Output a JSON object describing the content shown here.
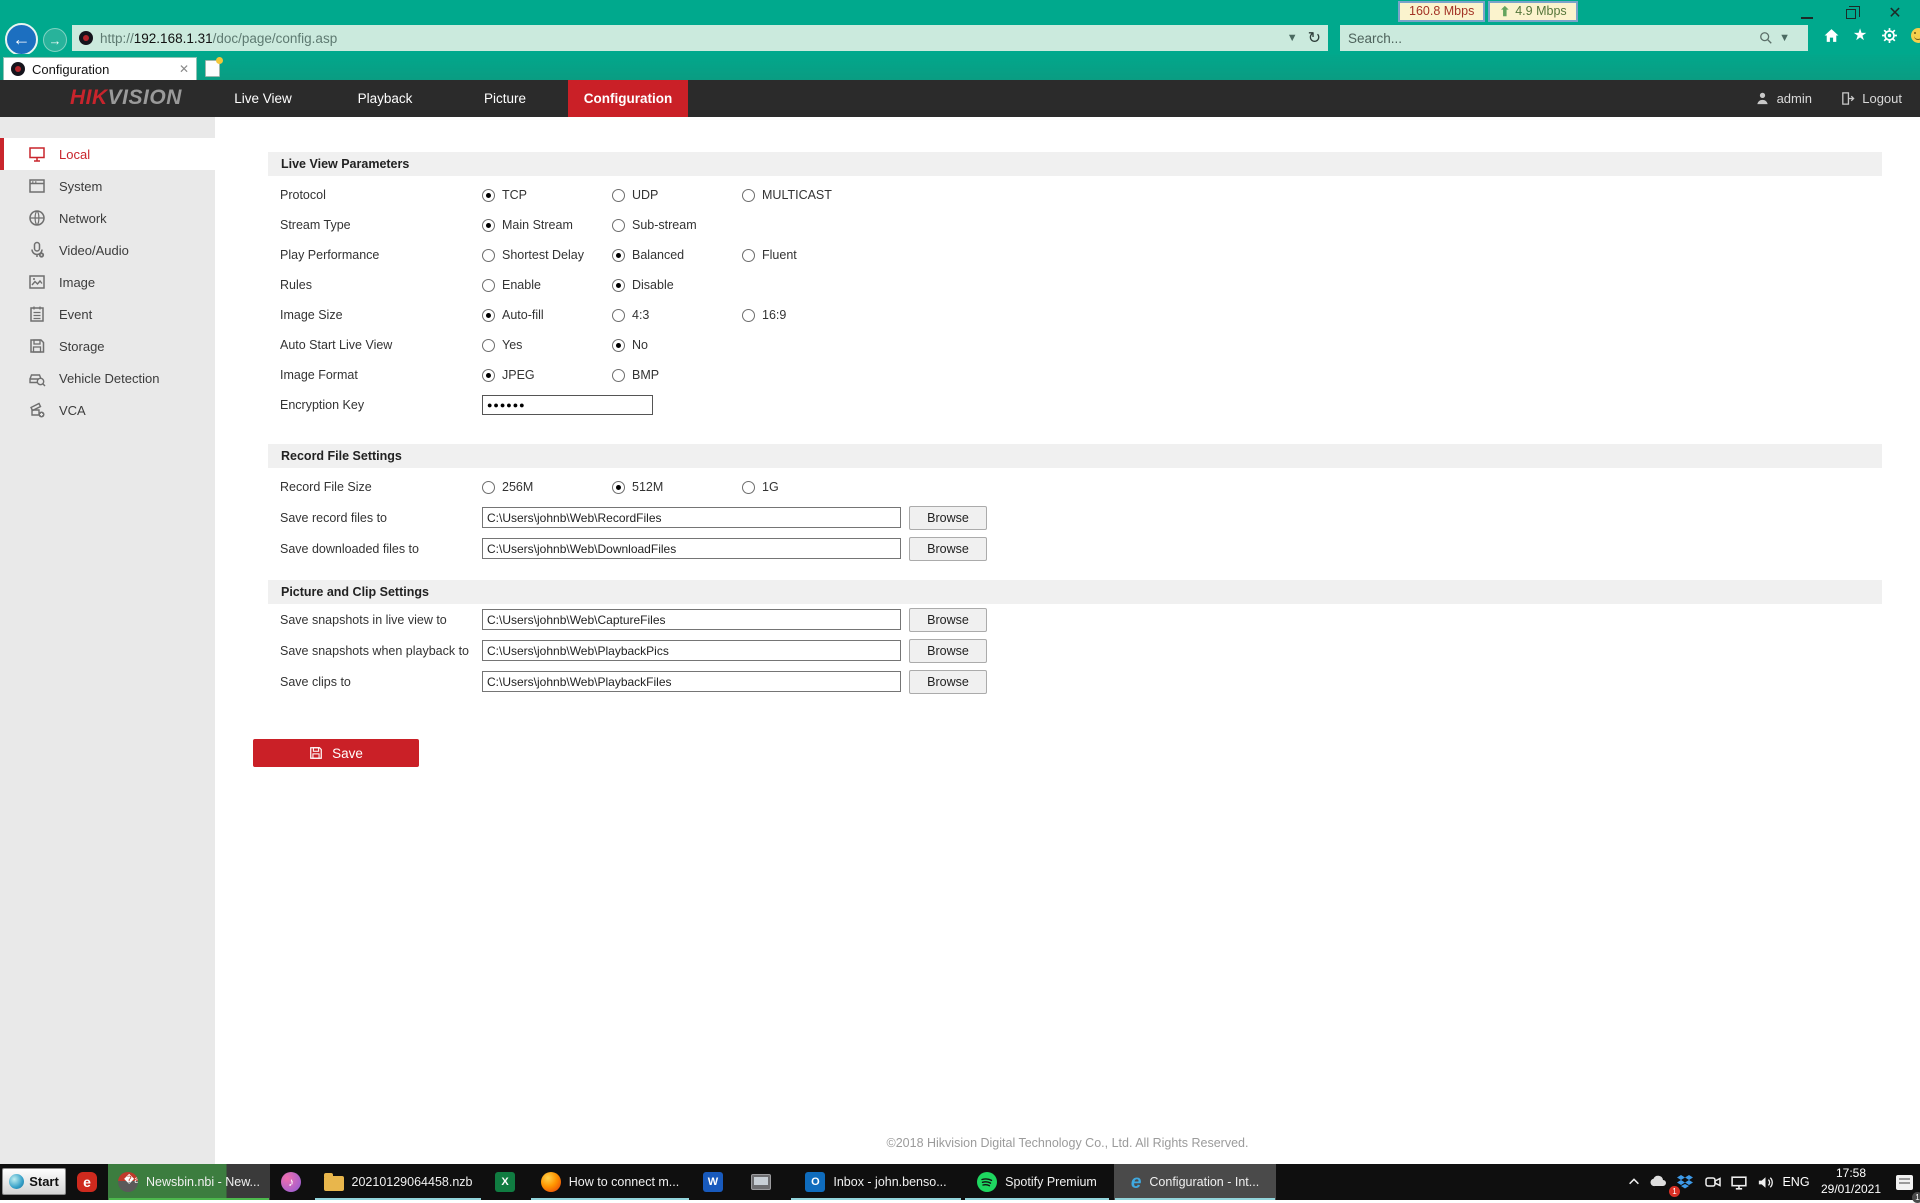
{
  "chrome": {
    "url_prefix": "http://",
    "url_domain": "192.168.1.31",
    "url_path": "/doc/page/config.asp",
    "search_placeholder": "Search...",
    "tab_title": "Configuration",
    "speed_download": "160.8 Mbps",
    "speed_upload": "4.9 Mbps"
  },
  "site": {
    "brand_red": "HIK",
    "brand_gray": "VISION",
    "nav": [
      {
        "label": "Live View",
        "active": false
      },
      {
        "label": "Playback",
        "active": false
      },
      {
        "label": "Picture",
        "active": false
      },
      {
        "label": "Configuration",
        "active": true
      }
    ],
    "user": "admin",
    "logout": "Logout"
  },
  "sidebar": {
    "items": [
      {
        "label": "Local",
        "active": true
      },
      {
        "label": "System",
        "active": false
      },
      {
        "label": "Network",
        "active": false
      },
      {
        "label": "Video/Audio",
        "active": false
      },
      {
        "label": "Image",
        "active": false
      },
      {
        "label": "Event",
        "active": false
      },
      {
        "label": "Storage",
        "active": false
      },
      {
        "label": "Vehicle Detection",
        "active": false
      },
      {
        "label": "VCA",
        "active": false
      }
    ]
  },
  "form": {
    "sections": {
      "lvp": {
        "title": "Live View Parameters",
        "rows": [
          {
            "label": "Protocol",
            "options": [
              {
                "label": "TCP",
                "selected": true
              },
              {
                "label": "UDP",
                "selected": false
              },
              {
                "label": "MULTICAST",
                "selected": false
              }
            ]
          },
          {
            "label": "Stream Type",
            "options": [
              {
                "label": "Main Stream",
                "selected": true
              },
              {
                "label": "Sub-stream",
                "selected": false
              }
            ]
          },
          {
            "label": "Play Performance",
            "options": [
              {
                "label": "Shortest Delay",
                "selected": false
              },
              {
                "label": "Balanced",
                "selected": true
              },
              {
                "label": "Fluent",
                "selected": false
              }
            ]
          },
          {
            "label": "Rules",
            "options": [
              {
                "label": "Enable",
                "selected": false
              },
              {
                "label": "Disable",
                "selected": true
              }
            ]
          },
          {
            "label": "Image Size",
            "options": [
              {
                "label": "Auto-fill",
                "selected": true
              },
              {
                "label": "4:3",
                "selected": false
              },
              {
                "label": "16:9",
                "selected": false
              }
            ]
          },
          {
            "label": "Auto Start Live View",
            "options": [
              {
                "label": "Yes",
                "selected": false
              },
              {
                "label": "No",
                "selected": true
              }
            ]
          },
          {
            "label": "Image Format",
            "options": [
              {
                "label": "JPEG",
                "selected": true
              },
              {
                "label": "BMP",
                "selected": false
              }
            ]
          }
        ],
        "encryption": {
          "label": "Encryption Key",
          "value": "●●●●●●"
        }
      },
      "rfs": {
        "title": "Record File Settings",
        "size_row": {
          "label": "Record File Size",
          "options": [
            {
              "label": "256M",
              "selected": false
            },
            {
              "label": "512M",
              "selected": true
            },
            {
              "label": "1G",
              "selected": false
            }
          ]
        },
        "paths": [
          {
            "label": "Save record files to",
            "value": "C:\\Users\\johnb\\Web\\RecordFiles",
            "button": "Browse"
          },
          {
            "label": "Save downloaded files to",
            "value": "C:\\Users\\johnb\\Web\\DownloadFiles",
            "button": "Browse"
          }
        ]
      },
      "pcs": {
        "title": "Picture and Clip Settings",
        "paths": [
          {
            "label": "Save snapshots in live view to",
            "value": "C:\\Users\\johnb\\Web\\CaptureFiles",
            "button": "Browse"
          },
          {
            "label": "Save snapshots when playback to",
            "value": "C:\\Users\\johnb\\Web\\PlaybackPics",
            "button": "Browse"
          },
          {
            "label": "Save clips to",
            "value": "C:\\Users\\johnb\\Web\\PlaybackFiles",
            "button": "Browse"
          }
        ]
      }
    },
    "save_label": "Save"
  },
  "footer": "©2018 Hikvision Digital Technology Co., Ltd. All Rights Reserved.",
  "taskbar": {
    "start": "Start",
    "tasks": {
      "newsbin": "Newsbin.nbi - New...",
      "nzb": "20210129064458.nzb",
      "firefox": "How to connect m...",
      "outlook": "Inbox - john.benso...",
      "spotify": "Spotify Premium",
      "ie": "Configuration - Int..."
    },
    "tray": {
      "lang": "ENG",
      "time": "17:58",
      "date": "29/01/2021",
      "dropbox_badge": "1",
      "notif_badge": "1"
    }
  }
}
